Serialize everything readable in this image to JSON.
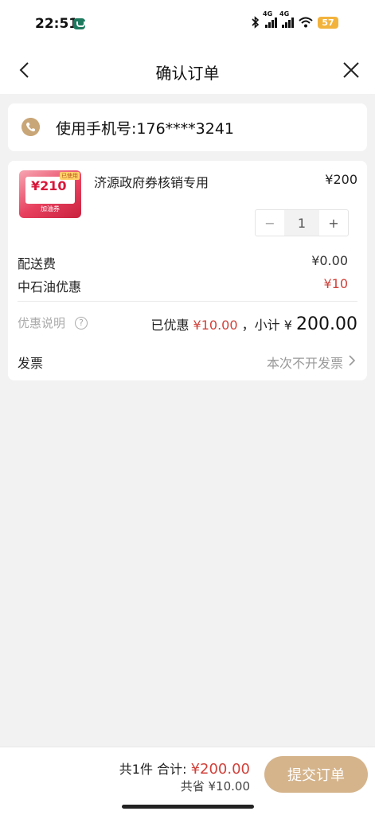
{
  "status_bar": {
    "time": "22:51",
    "network_1": "4G",
    "network_2": "4G",
    "battery": "57"
  },
  "nav": {
    "title": "确认订单"
  },
  "contact": {
    "phone_text": "使用手机号:176****3241"
  },
  "product": {
    "thumbnail": {
      "value": "¥210",
      "tag": "已使用",
      "bottom_label": "加油券"
    },
    "name": "济源政府券核销专用",
    "price": "¥200",
    "quantity": "1",
    "minus": "−",
    "plus": "+"
  },
  "fees": {
    "delivery_label": "配送费",
    "delivery_value": "¥0.00",
    "discount_label": "中石油优惠",
    "discount_value": "¥10"
  },
  "summary": {
    "help_label": "优惠说明",
    "help_icon": "?",
    "discounted_prefix": "已优惠",
    "discounted_value": "¥10.00",
    "subtotal_prefix": "，小计",
    "subtotal_currency": "¥",
    "subtotal_value": "200.00"
  },
  "invoice": {
    "label": "发票",
    "value": "本次不开发票"
  },
  "footer": {
    "count_label": "共1件 合计:",
    "total": "¥200.00",
    "saved": "共省 ¥10.00",
    "submit_label": "提交订单"
  },
  "colors": {
    "accent_gold": "#d5b48c",
    "price_red": "#d0413a",
    "battery": "#f2b33d"
  }
}
